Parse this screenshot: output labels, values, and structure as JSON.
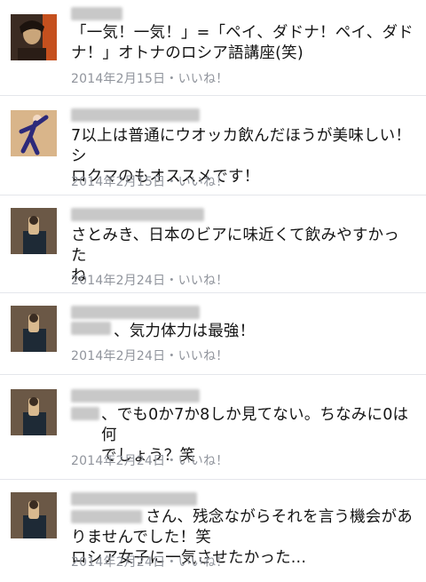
{
  "comments": [
    {
      "text": "「一気！一気！」=「ペイ、ダドナ！ペイ、ダド\nナ！」オトナのロシア語講座(笑)",
      "date": "2014年2月15日",
      "separator": "・",
      "like_label": "いいね！",
      "avatar_colors": [
        "#3b2b22",
        "#c9a57a",
        "#e85a1e"
      ]
    },
    {
      "text": "7以上は普通にウオッカ飲んだほうが美味しい！シ\nロクマのもオススメです！",
      "date": "2014年2月15日",
      "separator": "・",
      "like_label": "いいね！",
      "avatar_colors": [
        "#d9b58a",
        "#2d2a7a",
        "#f2d9c4"
      ]
    },
    {
      "text": "さとみき、日本のビアに味近くて飲みやすかった\nね",
      "date": "2014年2月24日",
      "separator": "・",
      "like_label": "いいね！",
      "avatar_colors": [
        "#6b5846",
        "#1e2a36",
        "#d8b98f"
      ]
    },
    {
      "text": "、気力体力は最強！",
      "date": "2014年2月24日",
      "separator": "・",
      "like_label": "いいね！",
      "avatar_colors": [
        "#6b5846",
        "#1e2a36",
        "#d8b98f"
      ]
    },
    {
      "text": "、でも0か7か8しか見てない。ちなみに0は何\nでしょう？笑",
      "date": "2014年2月24日",
      "separator": "・",
      "like_label": "いいね！",
      "avatar_colors": [
        "#6b5846",
        "#1e2a36",
        "#d8b98f"
      ]
    },
    {
      "text": "さん、残念ながらそれを言う機会がありませんでした！笑\nロシア女子に一気させたかった...",
      "date": "2014年2月24日",
      "separator": "・",
      "like_label": "いいね！",
      "avatar_colors": [
        "#6b5846",
        "#1e2a36",
        "#d8b98f"
      ]
    }
  ]
}
